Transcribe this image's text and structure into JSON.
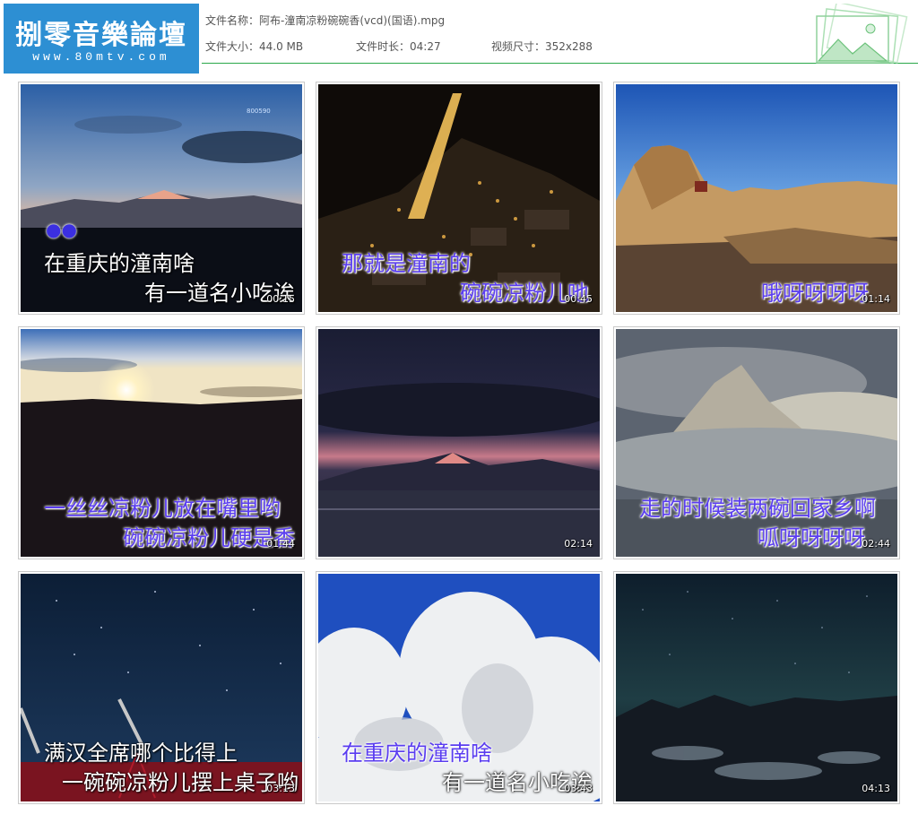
{
  "logo": {
    "title": "捌零音樂論壇",
    "url": "www.80mtv.com"
  },
  "file_info": {
    "name_label": "文件名称：",
    "name_value": "阿布-潼南凉粉碗碗香(vcd)(国语).mpg",
    "size_label": "文件大小：",
    "size_value": "44.0 MB",
    "duration_label": "文件时长：",
    "duration_value": "04:27",
    "dimensions_label": "视频尺寸：",
    "dimensions_value": "352x288"
  },
  "colors": {
    "logo_bg": "#2d8fd3",
    "rule": "#2aa84a",
    "subtitle_blue": "#5a3df0",
    "subtitle_white": "#ffffff"
  },
  "thumbnails": [
    {
      "time": "00:15",
      "line1": "在重庆的潼南啥",
      "line2": "有一道名小吃诶",
      "style": "white",
      "marker": "●●",
      "channel": "800590"
    },
    {
      "time": "00:45",
      "line1": "那就是潼南的",
      "line2": "碗碗凉粉儿吔",
      "style": "blue"
    },
    {
      "time": "01:14",
      "line1": "",
      "line2": "哦呀呀呀呀",
      "style": "blue"
    },
    {
      "time": "01:44",
      "line1": "一丝丝凉粉儿放在嘴里哟",
      "line2": "碗碗凉粉儿硬是香",
      "style": "blue"
    },
    {
      "time": "02:14",
      "line1": "",
      "line2": "",
      "style": "white"
    },
    {
      "time": "02:44",
      "line1": "走的时候装两碗回家乡啊",
      "line2": "呱呀呀呀呀",
      "style": "blue"
    },
    {
      "time": "03:13",
      "line1": "满汉全席哪个比得上",
      "line2": "一碗碗凉粉儿摆上桌子哟",
      "style": "white"
    },
    {
      "time": "03:43",
      "line1": "在重庆的潼南啥",
      "line2": "有一道名小吃诶",
      "style": "blue"
    },
    {
      "time": "04:13",
      "line1": "",
      "line2": "",
      "style": "white"
    }
  ]
}
